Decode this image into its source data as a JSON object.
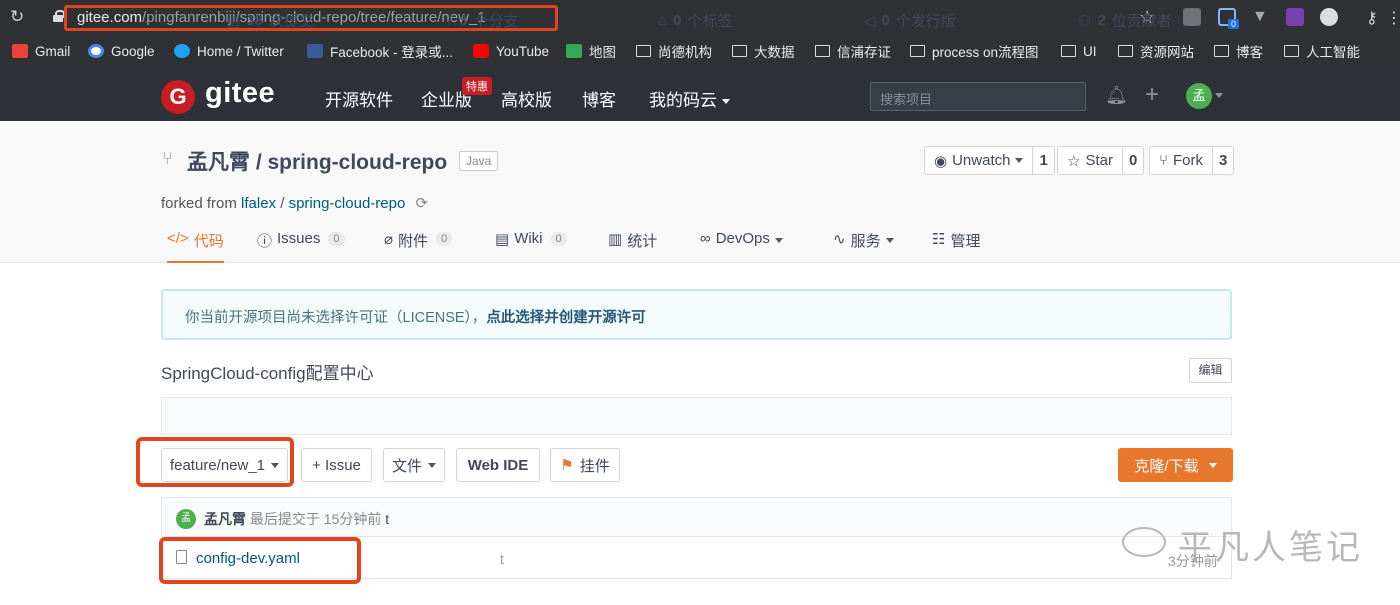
{
  "browser": {
    "url_host": "gitee.com",
    "url_path": "/pingfanrenbiji/spring-cloud-repo/tree/feature/new_1",
    "ext_badge": "0",
    "bookmarks": [
      "Gmail",
      "Google",
      "Home / Twitter",
      "Facebook - 登录或...",
      "YouTube",
      "地图",
      "尚德机构",
      "大数据",
      "信浦存证",
      "process on流程图",
      "UI",
      "资源网站",
      "博客",
      "人工智能"
    ]
  },
  "header": {
    "logo_letter": "G",
    "logo_text": "gitee",
    "nav": [
      "开源软件",
      "企业版",
      "高校版",
      "博客",
      "我的码云"
    ],
    "hot_badge": "特惠",
    "search_placeholder": "搜索项目",
    "avatar_letter": "孟"
  },
  "repo": {
    "owner": "孟凡霄",
    "name": "spring-cloud-repo",
    "title": "孟凡霄 / spring-cloud-repo",
    "language": "Java",
    "watch_label": "Unwatch",
    "watch_count": "1",
    "star_label": "Star",
    "star_count": "0",
    "fork_label": "Fork",
    "fork_count": "3",
    "forked_prefix": "forked from",
    "forked_owner": "lfalex",
    "forked_sep": "/",
    "forked_repo": "spring-cloud-repo"
  },
  "tabs": [
    {
      "label": "代码",
      "badge": ""
    },
    {
      "label": "Issues",
      "badge": "0"
    },
    {
      "label": "附件",
      "badge": "0"
    },
    {
      "label": "Wiki",
      "badge": "0"
    },
    {
      "label": "统计",
      "badge": ""
    },
    {
      "label": "DevOps",
      "badge": ""
    },
    {
      "label": "服务",
      "badge": ""
    },
    {
      "label": "管理",
      "badge": ""
    }
  ],
  "notice": {
    "text": "你当前开源项目尚未选择许可证（LICENSE），",
    "link": "点此选择并创建开源许可"
  },
  "description": "SpringCloud-config配置中心",
  "edit_label": "编辑",
  "stats": [
    {
      "num": "38",
      "label": "次提交"
    },
    {
      "num": "3",
      "label": "个分支"
    },
    {
      "num": "0",
      "label": "个标签"
    },
    {
      "num": "0",
      "label": "个发行版"
    },
    {
      "num": "2",
      "label": "位贡献者"
    }
  ],
  "toolbar": {
    "branch": "feature/new_1",
    "issue": "+ Issue",
    "file": "文件",
    "webide": "Web IDE",
    "attach": "挂件",
    "clone": "克隆/下载"
  },
  "commit": {
    "avatar_letter": "孟",
    "author": "孟凡霄",
    "info": "最后提交于 15分钟前",
    "message": "t"
  },
  "files": [
    {
      "name": "config-dev.yaml",
      "message": "t",
      "time": "3分钟前"
    }
  ],
  "watermark": "平凡人笔记",
  "colors": {
    "accent": "#e8772e",
    "brand": "#c71d23",
    "highlight": "#e2451b"
  }
}
